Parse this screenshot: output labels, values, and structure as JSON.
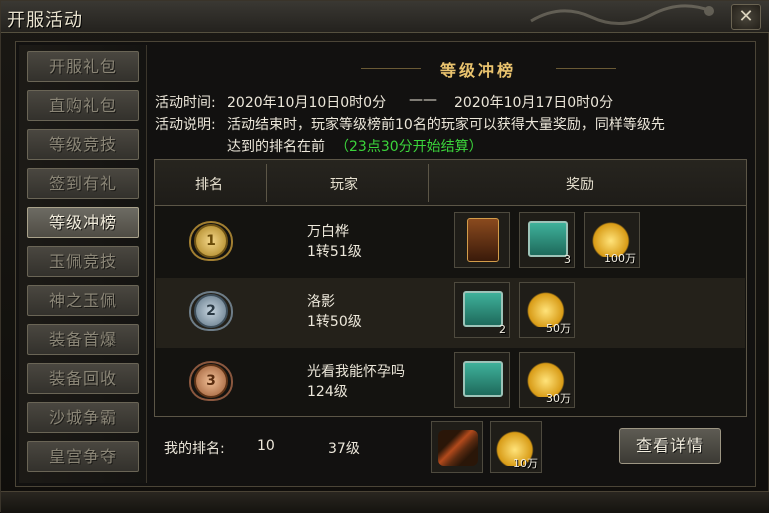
{
  "window": {
    "title": "开服活动",
    "close_label": "✕"
  },
  "sidebar": {
    "items": [
      {
        "label": "开服礼包",
        "active": false
      },
      {
        "label": "直购礼包",
        "active": false
      },
      {
        "label": "等级竞技",
        "active": false
      },
      {
        "label": "签到有礼",
        "active": false
      },
      {
        "label": "等级冲榜",
        "active": true
      },
      {
        "label": "玉佩竞技",
        "active": false
      },
      {
        "label": "神之玉佩",
        "active": false
      },
      {
        "label": "装备首爆",
        "active": false
      },
      {
        "label": "装备回收",
        "active": false
      },
      {
        "label": "沙城争霸",
        "active": false
      },
      {
        "label": "皇宫争夺",
        "active": false
      }
    ]
  },
  "panel": {
    "title": "等级冲榜",
    "time_label": "活动时间:",
    "time_start": "2020年10月10日0时0分",
    "time_sep": "——",
    "time_end": "2020年10月17日0时0分",
    "desc_label": "活动说明:",
    "desc_line1": "活动结束时，玩家等级榜前10名的玩家可以获得大量奖励，同样等级先",
    "desc_line2": "达到的排名在前",
    "desc_green": "（23点30分开始结算）"
  },
  "table": {
    "headers": [
      "排名",
      "玩家",
      "奖励"
    ],
    "rows": [
      {
        "rank": "1",
        "medal": "gold-medal",
        "name": "万白桦",
        "level": "1转51级",
        "rewards": [
          {
            "icon": "banner-icon",
            "qty": ""
          },
          {
            "icon": "chest-icon",
            "qty": "3"
          },
          {
            "icon": "gold-coins-icon",
            "qty": "100万"
          }
        ]
      },
      {
        "rank": "2",
        "medal": "silver-medal",
        "name": "洛影",
        "level": "1转50级",
        "rewards": [
          {
            "icon": "chest-icon",
            "qty": "2"
          },
          {
            "icon": "gold-coins-icon",
            "qty": "50万"
          }
        ]
      },
      {
        "rank": "3",
        "medal": "bronze-medal",
        "name": "光看我能怀孕吗",
        "level": "124级",
        "rewards": [
          {
            "icon": "chest-icon",
            "qty": ""
          },
          {
            "icon": "gold-coins-icon",
            "qty": "30万"
          }
        ]
      }
    ]
  },
  "my_rank": {
    "label": "我的排名:",
    "rank": "10",
    "level": "37级",
    "rewards": [
      {
        "icon": "scroll-icon",
        "qty": ""
      },
      {
        "icon": "gold-coins-icon",
        "qty": "10万"
      }
    ],
    "detail_button": "查看详情"
  },
  "colors": {
    "accent_gold": "#e9c36e",
    "highlight_green": "#3bd43b"
  }
}
